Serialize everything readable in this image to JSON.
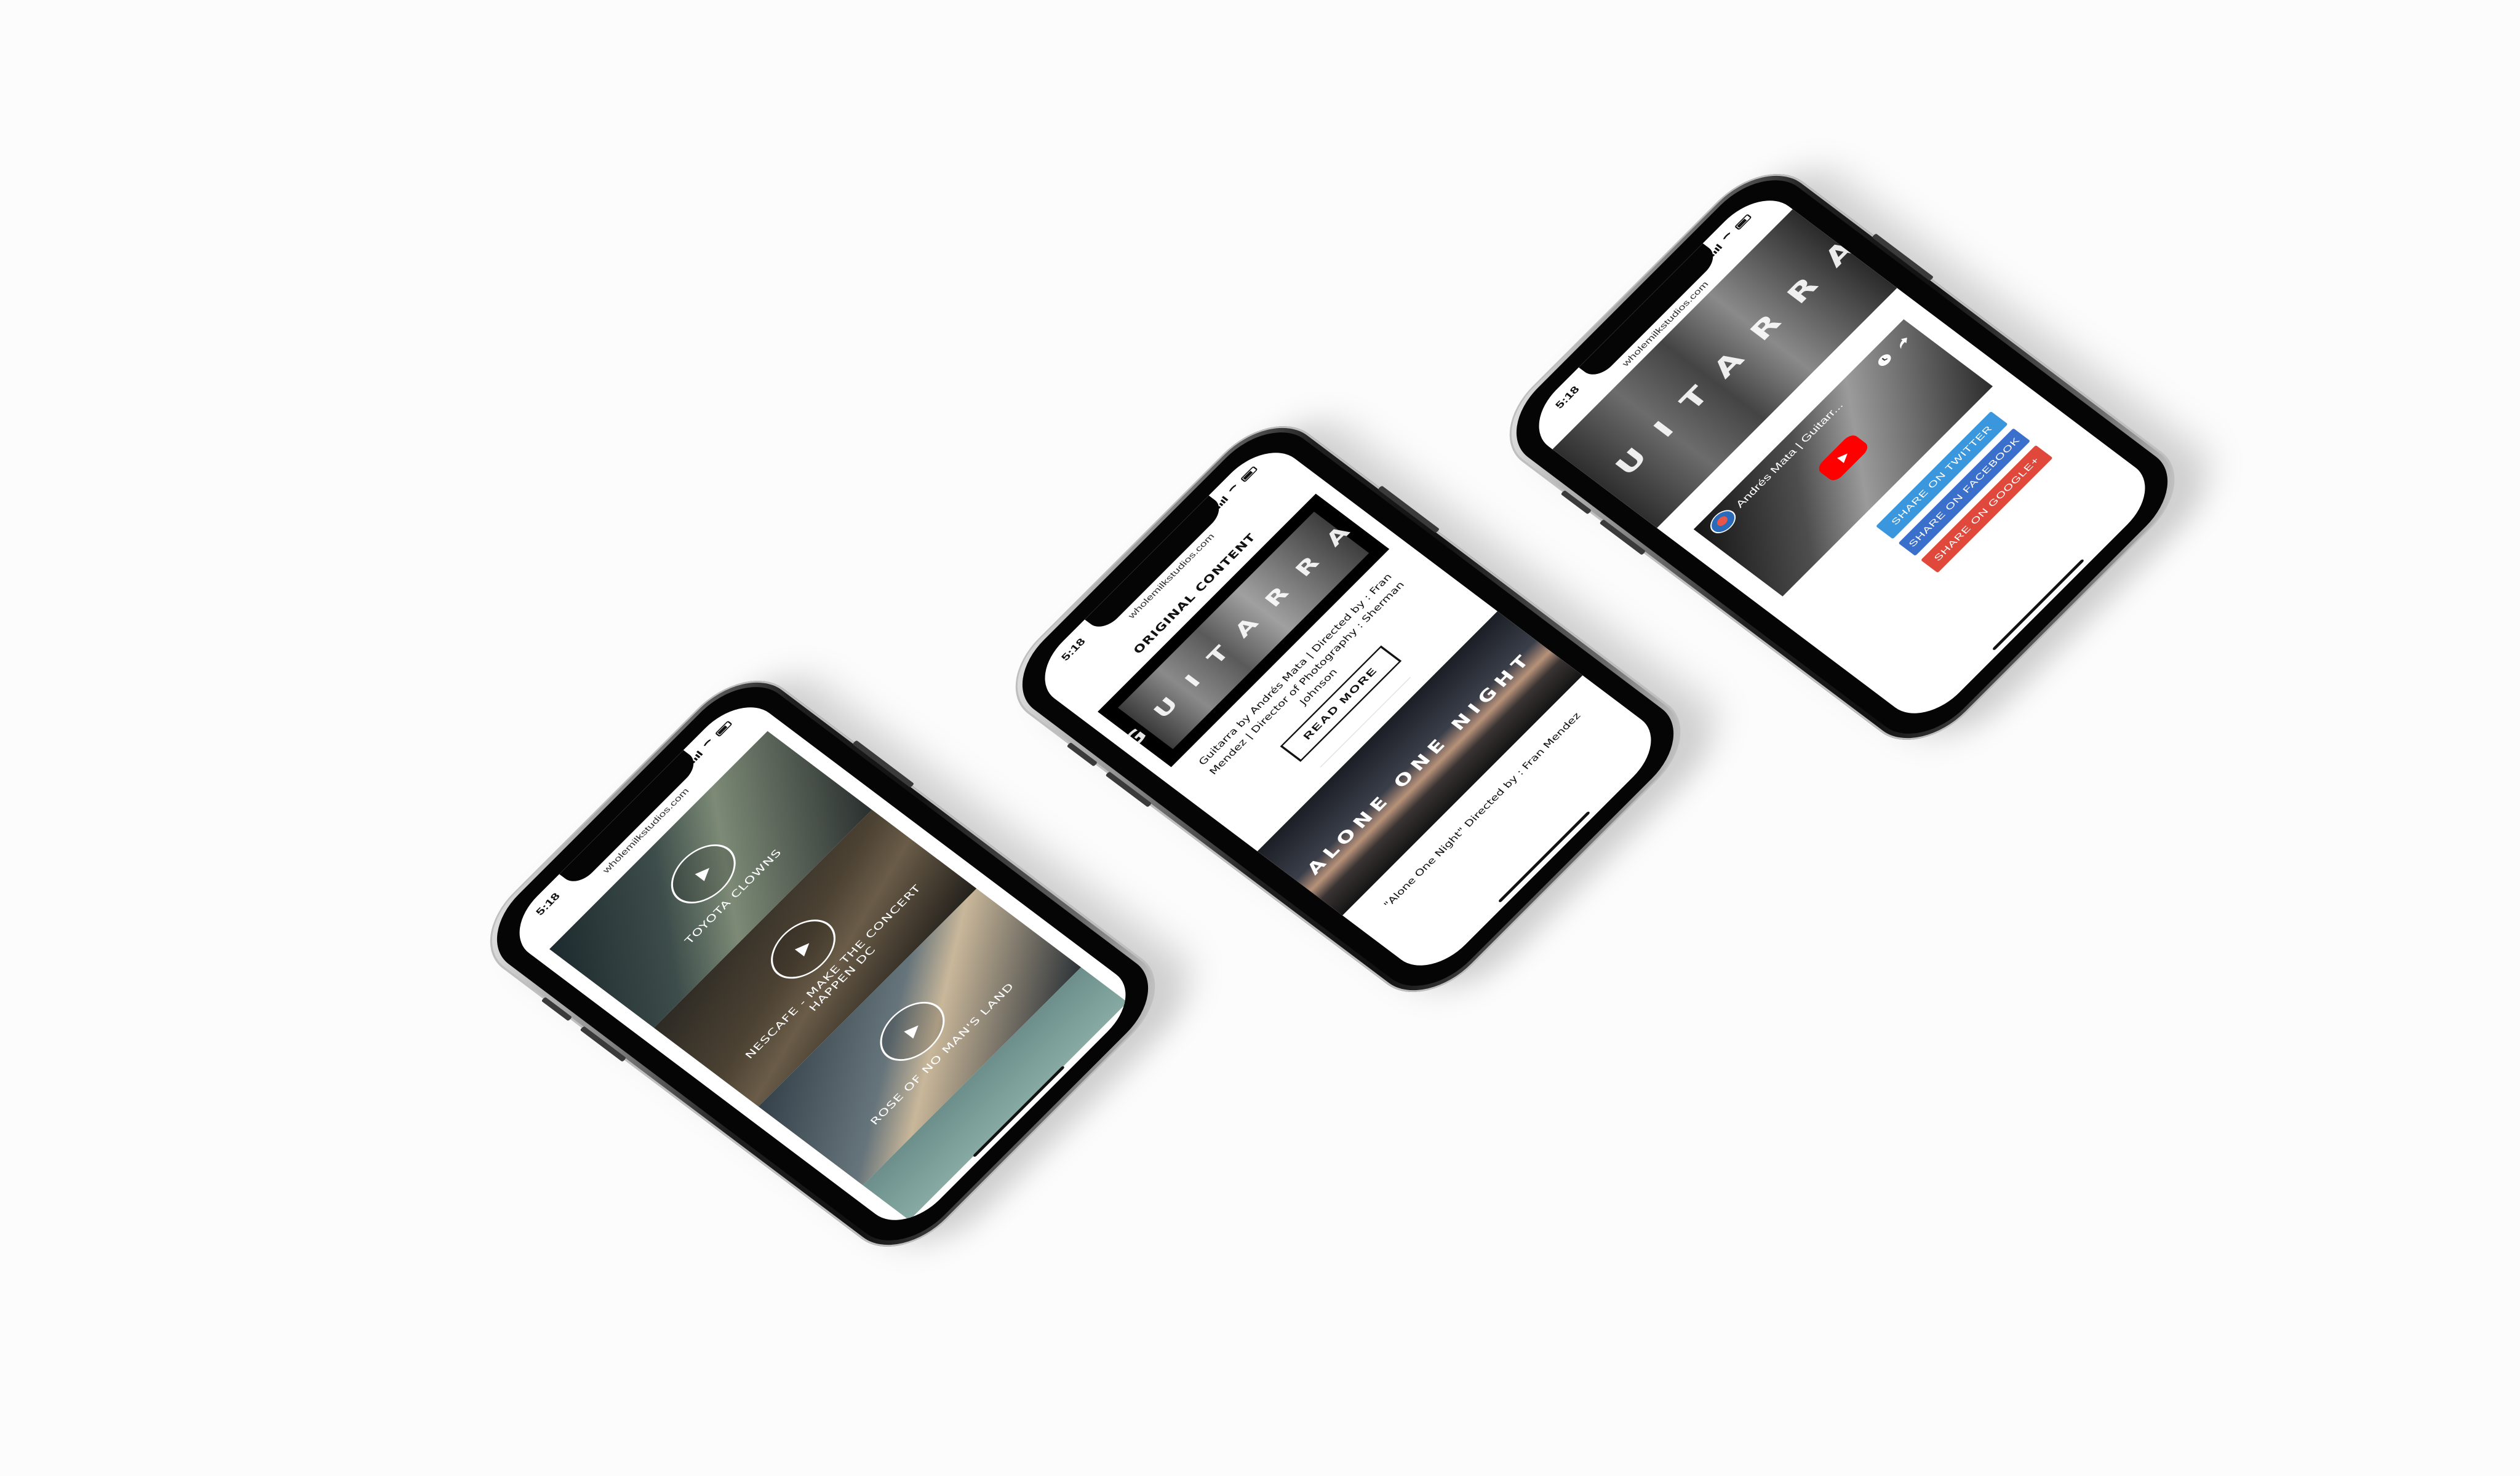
{
  "colors": {
    "twitter": "#3a97dd",
    "facebook": "#3b6fcc",
    "google_plus": "#e0483c",
    "youtube_red": "#ff0000"
  },
  "status": {
    "time": "5:18",
    "url": "wholemilkstudios.com"
  },
  "left_phone": {
    "videos": [
      {
        "title": "TOYOTA CLOWNS"
      },
      {
        "title": "NESCAFE - MAKE THE CONCERT HAPPEN DC"
      },
      {
        "title": "ROSE OF NO MAN'S LAND"
      }
    ]
  },
  "middle_phone": {
    "section_title": "ORIGINAL CONTENT",
    "hero_word": "GUITARRA",
    "post1_caption": "Guitarra by Andrés Mata | Directed by : Fran Mendez | Director of Photography : Sherman Johnson",
    "read_more": "READ MORE",
    "hero2_word": "ALONE ONE NIGHT",
    "post2_caption": "\"Alone One Night\" Directed by : Fran Mendez"
  },
  "right_phone": {
    "hero_word": "GUITARRA",
    "youtube": {
      "title": "Andrés Mata | Guitarr..."
    },
    "share": {
      "twitter": "SHARE ON TWITTER",
      "facebook": "SHARE ON FACEBOOK",
      "google": "SHARE ON GOOGLE+"
    }
  }
}
